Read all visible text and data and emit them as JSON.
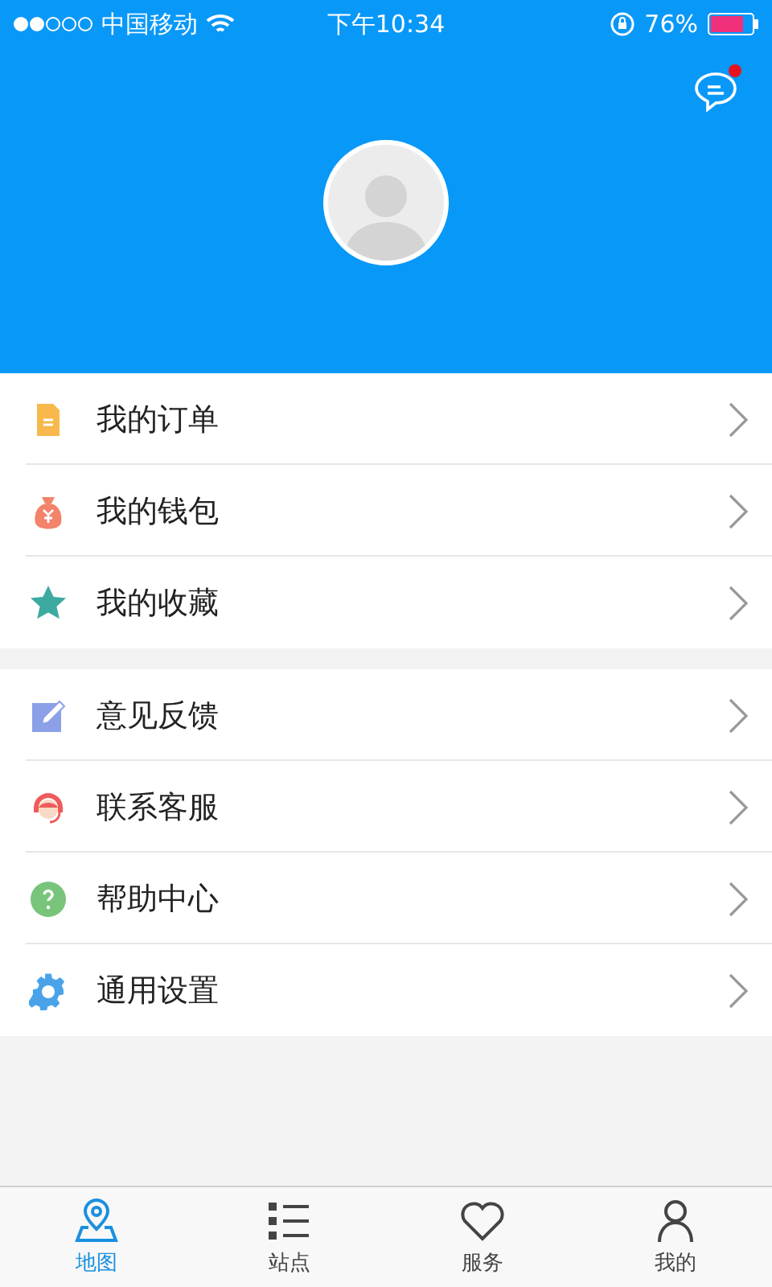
{
  "status_bar": {
    "carrier": "中国移动",
    "time": "下午10:34",
    "battery": "76%"
  },
  "header": {
    "unread": true
  },
  "menu_groups": [
    {
      "items": [
        {
          "label": "我的订单",
          "kind": "order"
        },
        {
          "label": "我的钱包",
          "kind": "wallet"
        },
        {
          "label": "我的收藏",
          "kind": "star"
        }
      ]
    },
    {
      "items": [
        {
          "label": "意见反馈",
          "kind": "feedback"
        },
        {
          "label": "联系客服",
          "kind": "support"
        },
        {
          "label": "帮助中心",
          "kind": "help"
        },
        {
          "label": "通用设置",
          "kind": "settings"
        }
      ]
    }
  ],
  "tabs": [
    {
      "label": "地图",
      "kind": "map",
      "selected": true
    },
    {
      "label": "站点",
      "kind": "list",
      "selected": false
    },
    {
      "label": "服务",
      "kind": "heart",
      "selected": false
    },
    {
      "label": "我的",
      "kind": "person",
      "selected": false
    }
  ]
}
